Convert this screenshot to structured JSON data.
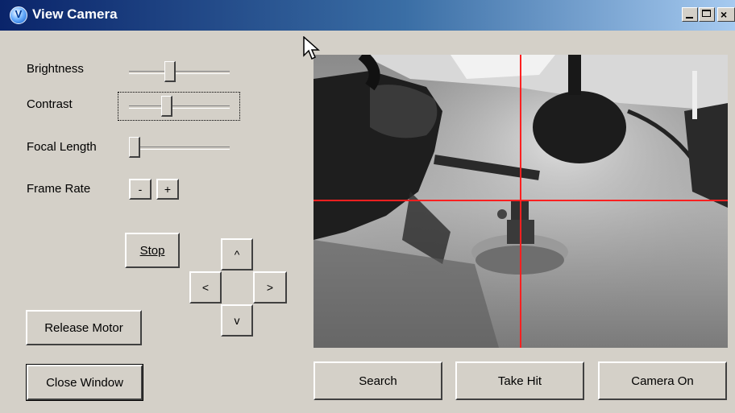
{
  "window": {
    "title": "View Camera",
    "icon": "app-icon",
    "icon_letter": "V",
    "title_bar_buttons": [
      "minimize",
      "maximize",
      "close"
    ]
  },
  "controls": {
    "brightness": {
      "label": "Brightness",
      "level": 0.4
    },
    "contrast": {
      "label": "Contrast",
      "level": 0.36
    },
    "focal_length": {
      "label": "Focal Length",
      "level": 0.0
    },
    "frame_rate": {
      "label": "Frame Rate",
      "minus": "-",
      "plus": "+"
    }
  },
  "buttons": {
    "stop": "Stop",
    "release_motor": "Release Motor",
    "close_window": "Close Window",
    "search": "Search",
    "take_hit": "Take Hit",
    "camera_on": "Camera On"
  },
  "direction_pad": {
    "up": "^",
    "left": "<",
    "right": ">",
    "down": "v"
  },
  "camera_view": {
    "crosshair_color": "#ff2020"
  }
}
